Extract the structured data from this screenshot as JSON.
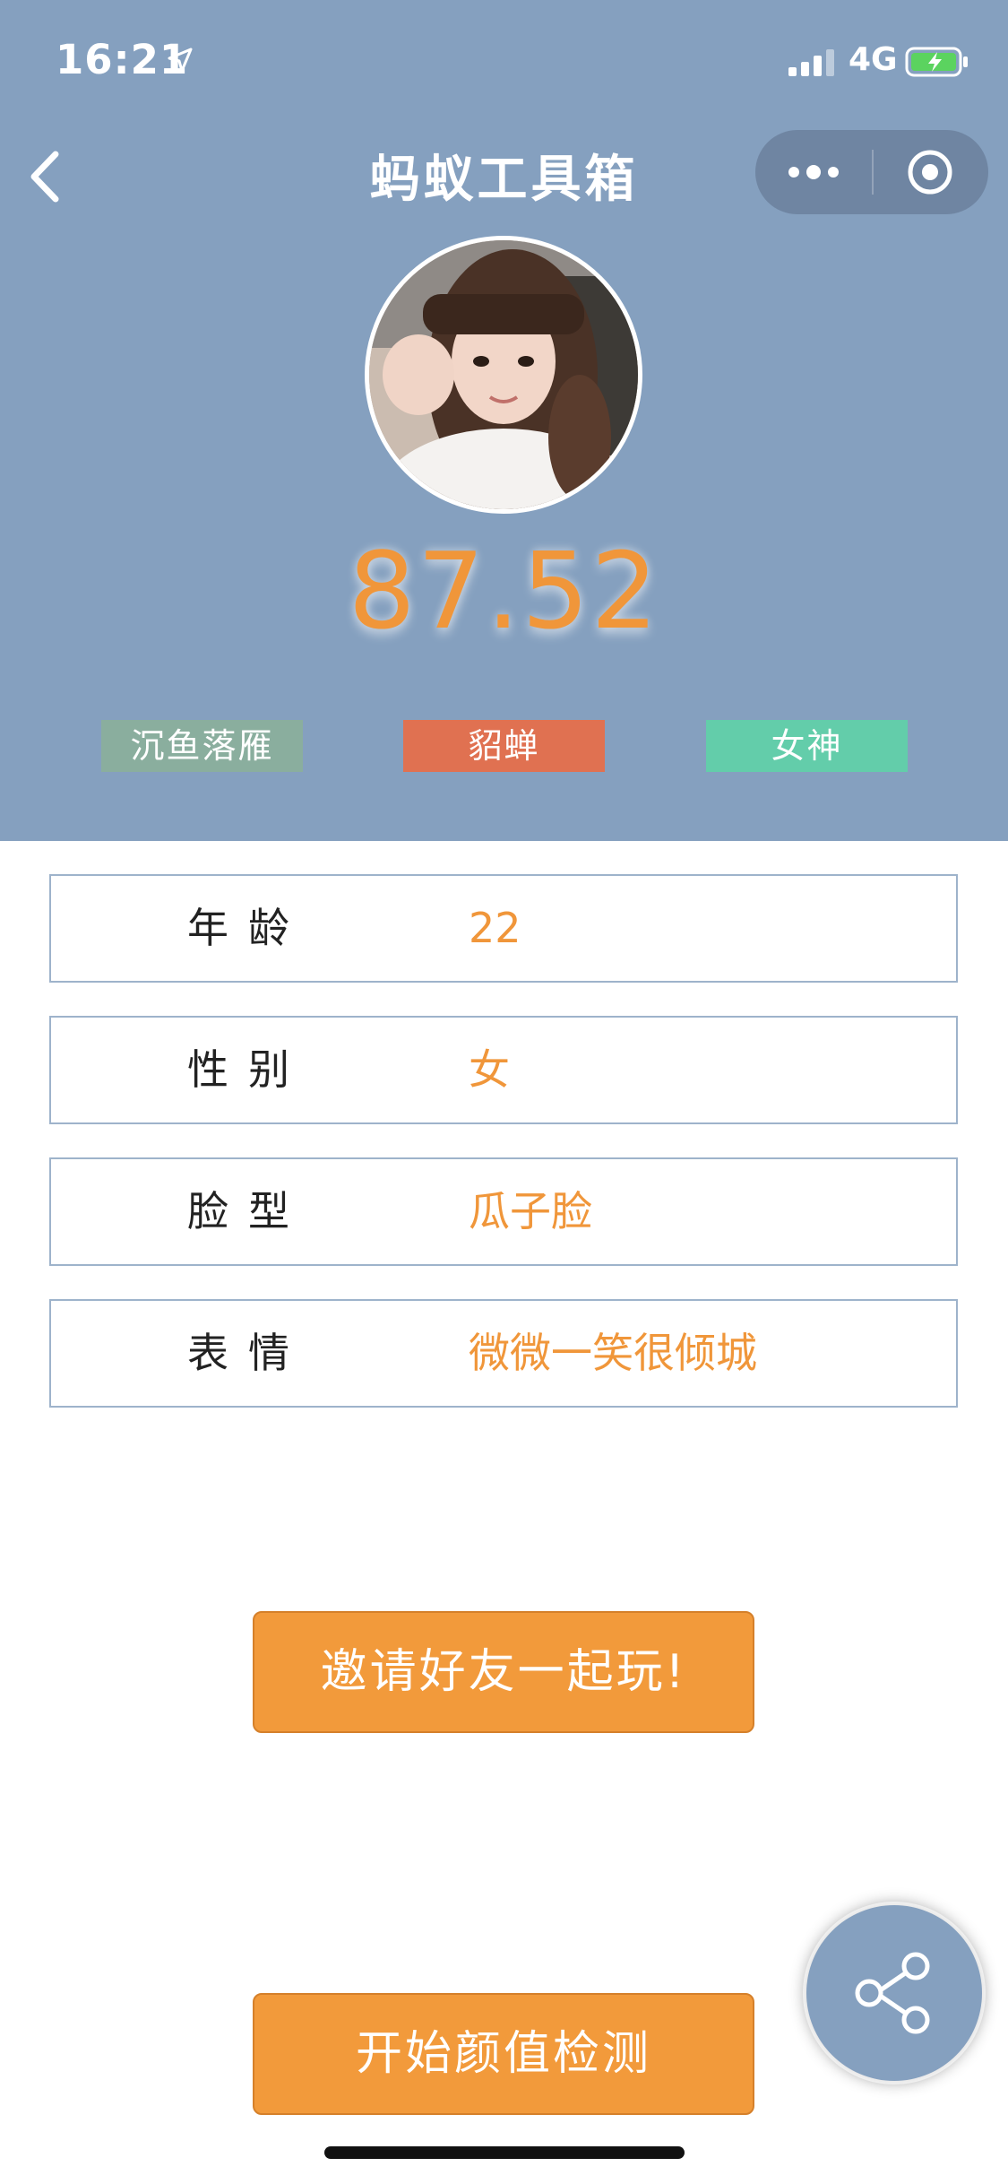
{
  "status_bar": {
    "time": "16:21",
    "network": "4G"
  },
  "nav": {
    "title": "蚂蚁工具箱"
  },
  "result": {
    "score": "87.52",
    "tags": [
      "沉鱼落雁",
      "貂蝉",
      "女神"
    ]
  },
  "info": [
    {
      "label": "年龄",
      "value": "22"
    },
    {
      "label": "性别",
      "value": "女"
    },
    {
      "label": "脸型",
      "value": "瓜子脸"
    },
    {
      "label": "表情",
      "value": "微微一笑很倾城"
    }
  ],
  "buttons": {
    "invite": "邀请好友一起玩!",
    "start": "开始颜值检测"
  },
  "colors": {
    "header_bg": "#85A0BF",
    "accent_orange": "#F29A3B",
    "tag_1": "#8AAE9E",
    "tag_2": "#E07151",
    "tag_3": "#63CDAA"
  },
  "icons": {
    "back": "chevron-left-icon",
    "more": "more-dots-icon",
    "close": "target-circle-icon",
    "share": "share-icon"
  }
}
